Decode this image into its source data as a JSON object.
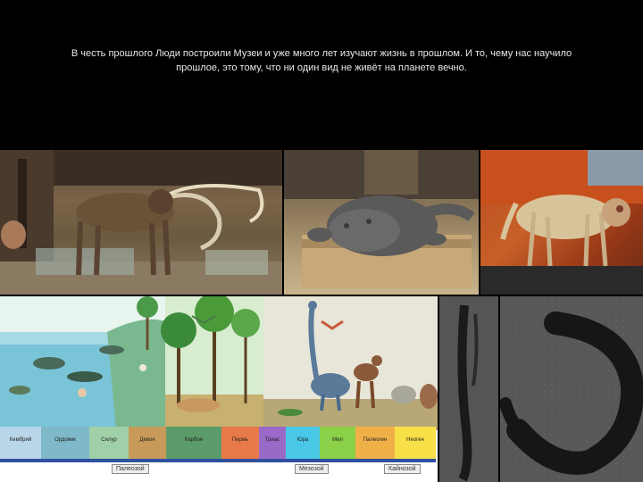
{
  "caption": {
    "line1": "В честь прошлого Люди построили Музеи и уже много лет изучают жизнь в прошлом. И то, чему нас научило",
    "line2": "прошлое, это тому, что ни один вид не живёт на планете вечно."
  },
  "timeline": {
    "periods": [
      {
        "label": "Кембрий",
        "color": "#b8d6e8"
      },
      {
        "label": "Ордовик",
        "color": "#7fb8c8"
      },
      {
        "label": "Силур",
        "color": "#9fd0a8"
      },
      {
        "label": "Девон",
        "color": "#c89a5a"
      },
      {
        "label": "Карбон",
        "color": "#5c9c6a"
      },
      {
        "label": "Пермь",
        "color": "#e87a4a"
      },
      {
        "label": "Триас",
        "color": "#9a6ac8"
      },
      {
        "label": "Юра",
        "color": "#4ac8e8"
      },
      {
        "label": "Мел",
        "color": "#8ad048"
      },
      {
        "label": "Палеоген",
        "color": "#f0b048"
      },
      {
        "label": "Неоген",
        "color": "#f8e048"
      }
    ],
    "eras": [
      "Палеозой",
      "Мезозой",
      "Кайнозой"
    ]
  }
}
